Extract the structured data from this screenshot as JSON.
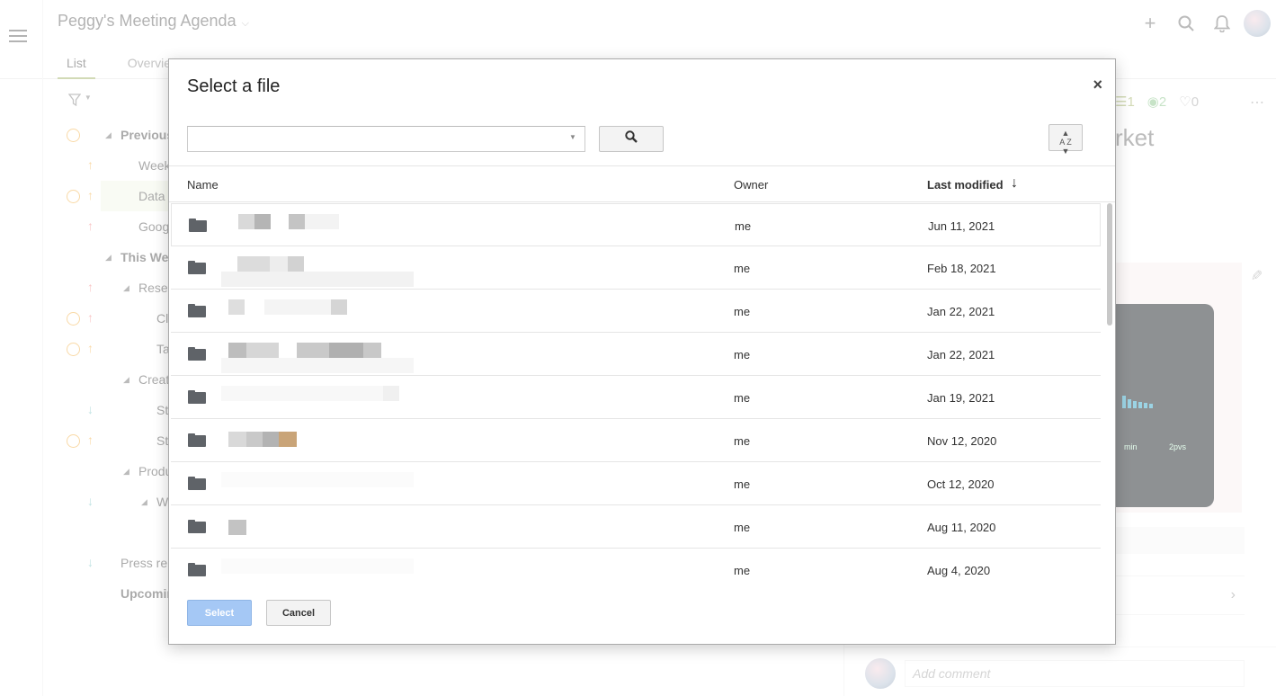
{
  "app": {
    "doc_title": "Peggy's Meeting Agenda",
    "tabs": [
      {
        "label": "List"
      },
      {
        "label": "Overview"
      }
    ],
    "filter_icon": "filter-icon",
    "tree": [
      {
        "label": "Previous",
        "bold": true
      },
      {
        "label": "Week"
      },
      {
        "label": "Data"
      },
      {
        "label": "Goog"
      },
      {
        "label": "This Wee",
        "bold": true
      },
      {
        "label": "Resea"
      },
      {
        "label": "Cl"
      },
      {
        "label": "Ta"
      },
      {
        "label": "Creat"
      },
      {
        "label": "St"
      },
      {
        "label": "St"
      },
      {
        "label": "Produ"
      },
      {
        "label": "W"
      },
      {
        "label": "Press rele"
      },
      {
        "label": "Upcomin",
        "bold": true
      }
    ],
    "panel": {
      "stat_list": "1",
      "stat_views": "2",
      "stat_likes": "0",
      "title": "rket",
      "laptop_texts": [
        "min",
        "2pvs"
      ],
      "comment_placeholder": "Add comment"
    }
  },
  "dialog": {
    "title": "Select a file",
    "search_value": "",
    "columns": {
      "name": "Name",
      "owner": "Owner",
      "last_modified": "Last modified"
    },
    "files": [
      {
        "owner": "me",
        "modified": "Jun 11, 2021"
      },
      {
        "owner": "me",
        "modified": "Feb 18, 2021"
      },
      {
        "owner": "me",
        "modified": "Jan 22, 2021"
      },
      {
        "owner": "me",
        "modified": "Jan 22, 2021"
      },
      {
        "owner": "me",
        "modified": "Jan 19, 2021"
      },
      {
        "owner": "me",
        "modified": "Nov 12, 2020"
      },
      {
        "owner": "me",
        "modified": "Oct 12, 2020"
      },
      {
        "owner": "me",
        "modified": "Aug 11, 2020"
      },
      {
        "owner": "me",
        "modified": "Aug 4, 2020"
      }
    ],
    "select_label": "Select",
    "cancel_label": "Cancel",
    "sort_icon_text": "A Z"
  },
  "colors": {
    "accent": "#a4b46d",
    "select_button": "#a5c8f5",
    "folder": "#5f6368"
  }
}
